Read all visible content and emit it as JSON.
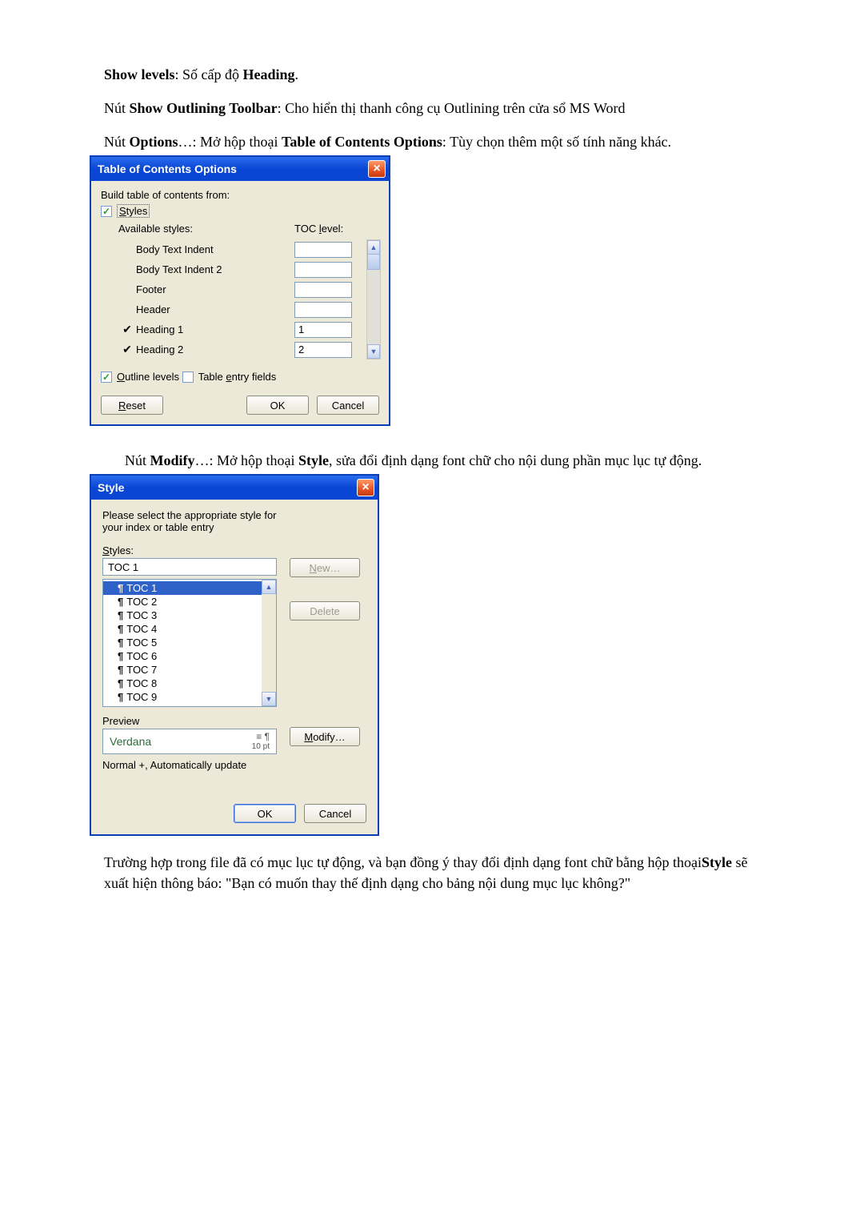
{
  "text": {
    "show_levels_lead": "Show levels",
    "show_levels_rest": ": Số cấp độ ",
    "show_levels_bold2": "Heading",
    "show_levels_end": ".",
    "p2_pre": "Nút ",
    "p2_bold": "Show Outlining Toolbar",
    "p2_rest": ": Cho hiển thị thanh công cụ Outlining trên cửa sổ MS Word",
    "p3_pre": "Nút ",
    "p3_bold1": "Options",
    "p3_mid": "…: Mở hộp thoại ",
    "p3_bold2": "Table of Contents Options",
    "p3_rest": ": Tùy chọn thêm một số tính năng khác.",
    "p4_pre": "Nút ",
    "p4_bold1": "Modify",
    "p4_mid": "…: Mở hộp thoại ",
    "p4_bold2": "Style",
    "p4_rest": ", sửa đổi định dạng font chữ cho nội dung phần mục lục tự động.",
    "p5_pre": "Trường hợp trong file đã có mục lục tự động, và bạn đồng ý thay đổi định dạng font chữ bằng hộp thoại",
    "p5_bold": "Style",
    "p5_rest": " sẽ xuất hiện thông báo: \"Bạn có muốn thay thế định dạng cho bảng nội dung mục lục không?\""
  },
  "toc_dialog": {
    "title": "Table of Contents Options",
    "build_from": "Build table of contents from:",
    "styles_cb": "Styles",
    "available_styles": "Available styles:",
    "toc_level": "TOC level:",
    "rows": [
      {
        "checked": false,
        "name": "Body Text Indent",
        "value": ""
      },
      {
        "checked": false,
        "name": "Body Text Indent 2",
        "value": ""
      },
      {
        "checked": false,
        "name": "Footer",
        "value": ""
      },
      {
        "checked": false,
        "name": "Header",
        "value": ""
      },
      {
        "checked": true,
        "name": "Heading 1",
        "value": "1"
      },
      {
        "checked": true,
        "name": "Heading 2",
        "value": "2"
      }
    ],
    "outline_levels": "Outline levels",
    "table_entry": "Table entry fields",
    "reset": "Reset",
    "ok": "OK",
    "cancel": "Cancel"
  },
  "style_dialog": {
    "title": "Style",
    "intro": "Please select the appropriate style for your index or table entry",
    "styles_label": "Styles:",
    "current": "TOC 1",
    "new": "New…",
    "delete": "Delete",
    "list": [
      "TOC 1",
      "TOC 2",
      "TOC 3",
      "TOC 4",
      "TOC 5",
      "TOC 6",
      "TOC 7",
      "TOC 8",
      "TOC 9"
    ],
    "preview_label": "Preview",
    "preview_font": "Verdana",
    "preview_size": "10 pt",
    "modify": "Modify…",
    "desc": "Normal +, Automatically update",
    "ok": "OK",
    "cancel": "Cancel"
  }
}
